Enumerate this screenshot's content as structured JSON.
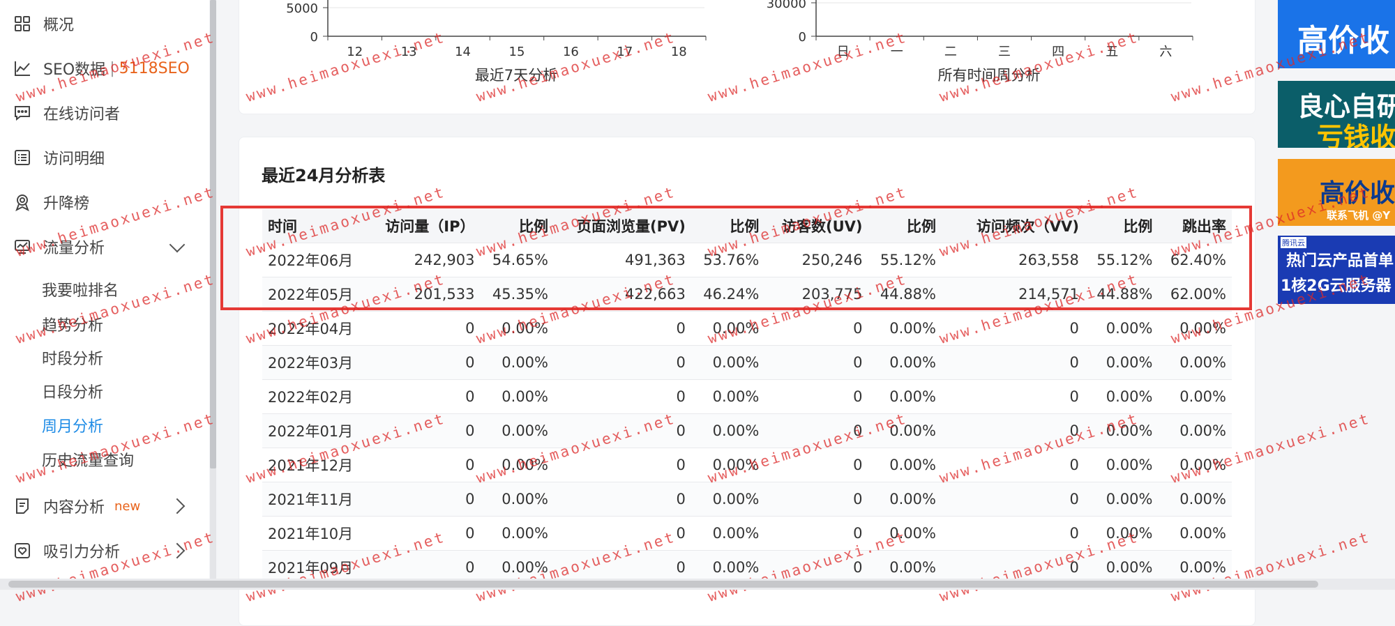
{
  "sidebar": {
    "overview": "概况",
    "seo_data": "SEO数据",
    "seo_brand": "5118SEO",
    "online_visitors": "在线访问者",
    "visit_detail": "访问明细",
    "ranking": "升降榜",
    "traffic_analysis": "流量分析",
    "sub": {
      "my_rank": "我要啦排名",
      "trend": "趋势分析",
      "period": "时段分析",
      "daily": "日段分析",
      "weekly_monthly": "周月分析",
      "history": "历史流量查询"
    },
    "content_analysis": "内容分析",
    "new_badge": "new",
    "attraction_analysis": "吸引力分析"
  },
  "charts": {
    "left": {
      "caption": "最近7天分析",
      "y_ticks": [
        "5000",
        "0"
      ],
      "x_ticks": [
        "12",
        "13",
        "14",
        "15",
        "16",
        "17",
        "18"
      ]
    },
    "right": {
      "caption": "所有时间周分析",
      "y_ticks": [
        "30000",
        "0"
      ],
      "x_ticks": [
        "日",
        "一",
        "二",
        "三",
        "四",
        "五",
        "六"
      ]
    }
  },
  "table": {
    "title": "最近24月分析表",
    "headers": [
      "时间",
      "访问量（IP）",
      "比例",
      "页面浏览量(PV)",
      "比例",
      "访客数(UV)",
      "比例",
      "访问频次（VV)",
      "比例",
      "跳出率"
    ],
    "rows": [
      [
        "2022年06月",
        "242,903",
        "54.65%",
        "491,363",
        "53.76%",
        "250,246",
        "55.12%",
        "263,558",
        "55.12%",
        "62.40%"
      ],
      [
        "2022年05月",
        "201,533",
        "45.35%",
        "422,663",
        "46.24%",
        "203,775",
        "44.88%",
        "214,571",
        "44.88%",
        "62.00%"
      ],
      [
        "2022年04月",
        "0",
        "0.00%",
        "0",
        "0.00%",
        "0",
        "0.00%",
        "0",
        "0.00%",
        "0.00%"
      ],
      [
        "2022年03月",
        "0",
        "0.00%",
        "0",
        "0.00%",
        "0",
        "0.00%",
        "0",
        "0.00%",
        "0.00%"
      ],
      [
        "2022年02月",
        "0",
        "0.00%",
        "0",
        "0.00%",
        "0",
        "0.00%",
        "0",
        "0.00%",
        "0.00%"
      ],
      [
        "2022年01月",
        "0",
        "0.00%",
        "0",
        "0.00%",
        "0",
        "0.00%",
        "0",
        "0.00%",
        "0.00%"
      ],
      [
        "2021年12月",
        "0",
        "0.00%",
        "0",
        "0.00%",
        "0",
        "0.00%",
        "0",
        "0.00%",
        "0.00%"
      ],
      [
        "2021年11月",
        "0",
        "0.00%",
        "0",
        "0.00%",
        "0",
        "0.00%",
        "0",
        "0.00%",
        "0.00%"
      ],
      [
        "2021年10月",
        "0",
        "0.00%",
        "0",
        "0.00%",
        "0",
        "0.00%",
        "0",
        "0.00%",
        "0.00%"
      ],
      [
        "2021年09月",
        "0",
        "0.00%",
        "0",
        "0.00%",
        "0",
        "0.00%",
        "0",
        "0.00%",
        "0.00%"
      ]
    ]
  },
  "ads": {
    "ad1": "高价收",
    "ad2_line1": "良心自研",
    "ad2_line2": "亏钱收",
    "ad3_line1": "高价收",
    "ad3_line2": "联系飞机 @Y",
    "ad4_tag": "腾讯云",
    "ad4_line1": "热门云产品首单",
    "ad4_line2": "1核2G云服务器"
  },
  "watermark": "www.heimaoxuexi.net",
  "colors": {
    "accent": "#1f8ce6",
    "brand": "#e8631b",
    "highlight": "#e53935"
  }
}
